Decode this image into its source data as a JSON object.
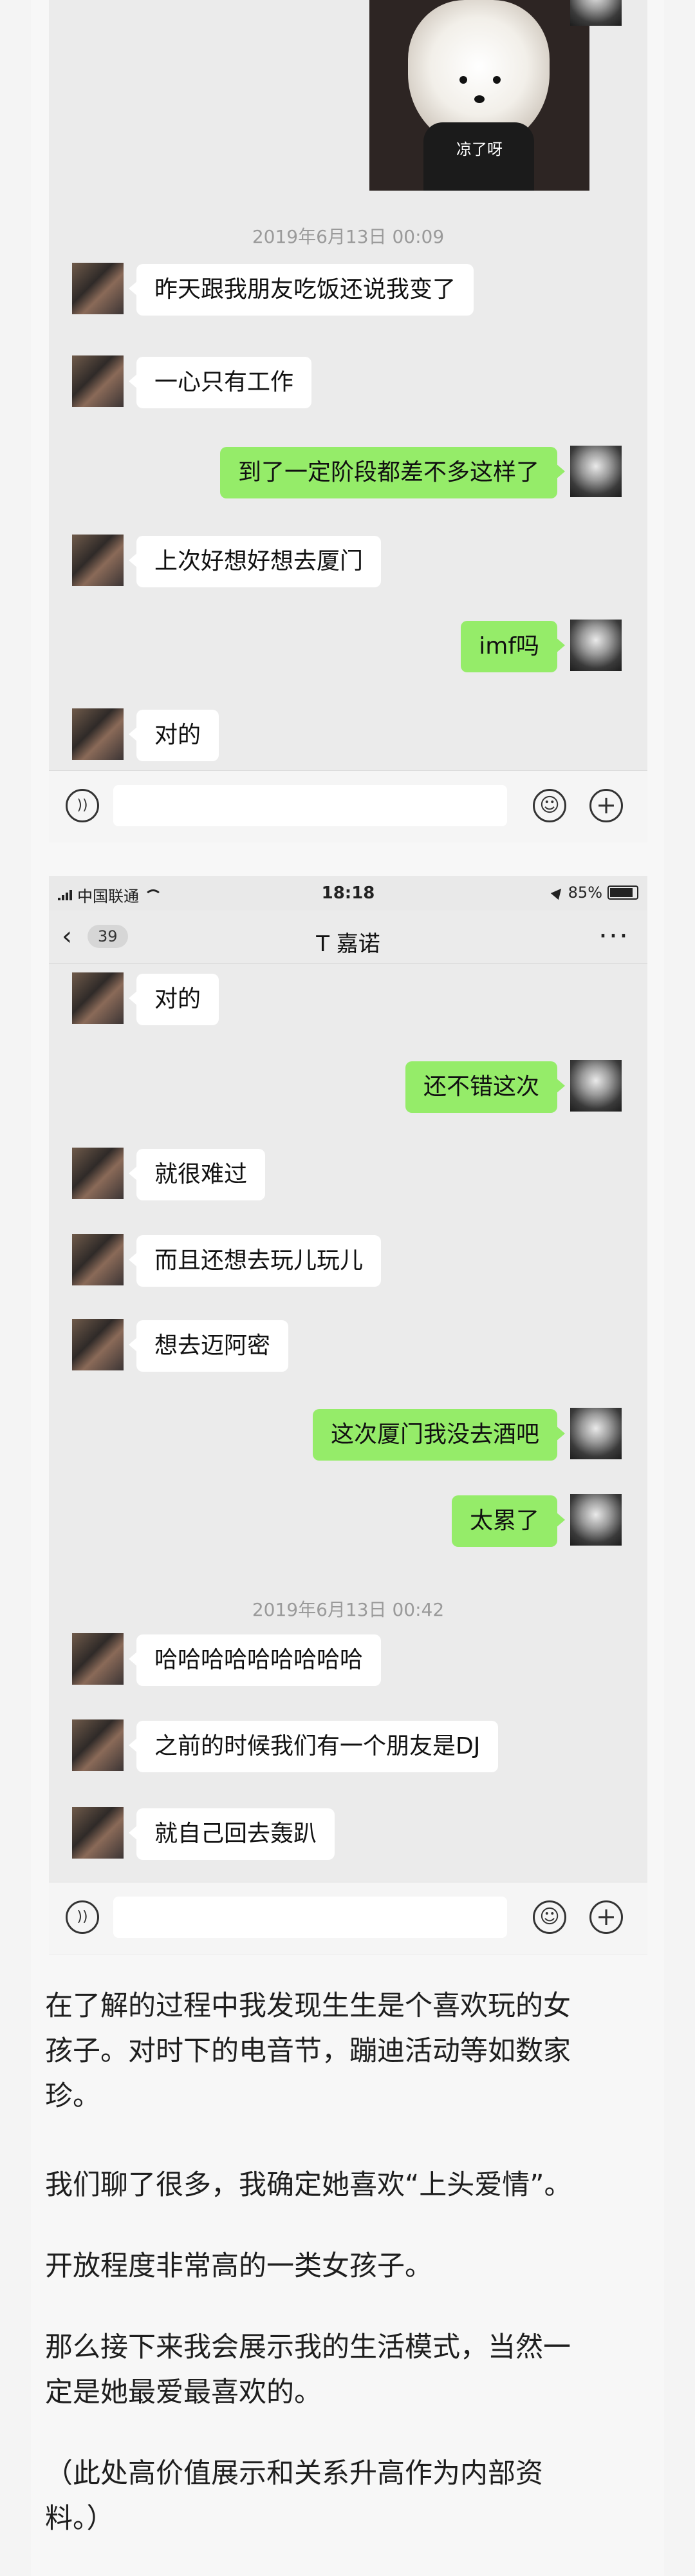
{
  "screenshot1": {
    "sticker": {
      "caption": "凉了呀"
    },
    "timestamp1": "2019年6月13日 00:09",
    "messages": [
      {
        "side": "left",
        "text": "昨天跟我朋友吃饭还说我变了"
      },
      {
        "side": "left",
        "text": "一心只有工作"
      },
      {
        "side": "right",
        "text": "到了一定阶段都差不多这样了"
      },
      {
        "side": "left",
        "text": "上次好想好想去厦门"
      },
      {
        "side": "right",
        "text": "imf吗"
      },
      {
        "side": "left",
        "text": "对的"
      }
    ]
  },
  "screenshot2": {
    "statusbar": {
      "carrier": "中国联通",
      "time": "18:18",
      "battery": "85%"
    },
    "navbar": {
      "unread": "39",
      "title": "T 嘉诺"
    },
    "timestamp1": "2019年6月13日 00:42",
    "messages": [
      {
        "side": "left",
        "text": "对的"
      },
      {
        "side": "right",
        "text": "还不错这次"
      },
      {
        "side": "left",
        "text": "就很难过"
      },
      {
        "side": "left",
        "text": "而且还想去玩儿玩儿"
      },
      {
        "side": "left",
        "text": "想去迈阿密"
      },
      {
        "side": "right",
        "text": "这次厦门我没去酒吧"
      },
      {
        "side": "right",
        "text": "太累了"
      },
      {
        "side": "left",
        "text": "哈哈哈哈哈哈哈哈哈"
      },
      {
        "side": "left",
        "text": "之前的时候我们有一个朋友是DJ"
      },
      {
        "side": "left",
        "text": "就自己回去轰趴"
      }
    ]
  },
  "article": {
    "p1_line1": "在了解的过程中我发现生生是个喜欢玩的女",
    "p1_line2": "孩子。对时下的电音节，蹦迪活动等如数家",
    "p1_line3": "珍。",
    "p2": "我们聊了很多，我确定她喜欢“上头爱情”。",
    "p3": "开放程度非常高的一类女孩子。",
    "p4_line1": "那么接下来我会展示我的生活模式，当然一",
    "p4_line2": "定是她最爱最喜欢的。",
    "p5_line1": "（此处高价值展示和关系升高作为内部资",
    "p5_line2": "料。）"
  },
  "colors": {
    "sent_bubble": "#95ec69",
    "received_bubble": "#ffffff",
    "chat_bg": "#ebebeb"
  }
}
